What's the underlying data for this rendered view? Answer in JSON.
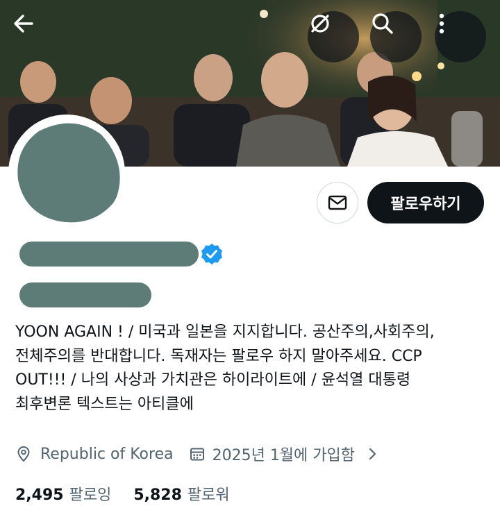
{
  "header": {
    "back_icon": "arrow-left-icon",
    "grok_icon": "grok-icon",
    "search_icon": "search-icon",
    "more_icon": "more-vertical-icon"
  },
  "profile": {
    "bio": "YOON AGAIN ! / 미국과 일본을 지지합니다. 공산주의,사회주의,\n전체주의를 반대합니다. 독재자는 팔로우 하지 말아주세요. CCP\nOUT!!! / 나의 사상과 가치관은 하이라이트에 / 윤석열 대통령\n최후변론 텍스트는 아티클에",
    "location": "Republic of Korea",
    "joined": "2025년 1월에 가입함",
    "verified": true
  },
  "actions": {
    "follow_label": "팔로우하기",
    "message_icon": "mail-icon"
  },
  "stats": {
    "following_count": "2,495",
    "following_label": "팔로잉",
    "followers_count": "5,828",
    "followers_label": "팔로워"
  },
  "colors": {
    "accent": "#1d9bf0",
    "text_primary": "#0f1419",
    "text_secondary": "#536471",
    "redaction": "#5d7b77"
  }
}
